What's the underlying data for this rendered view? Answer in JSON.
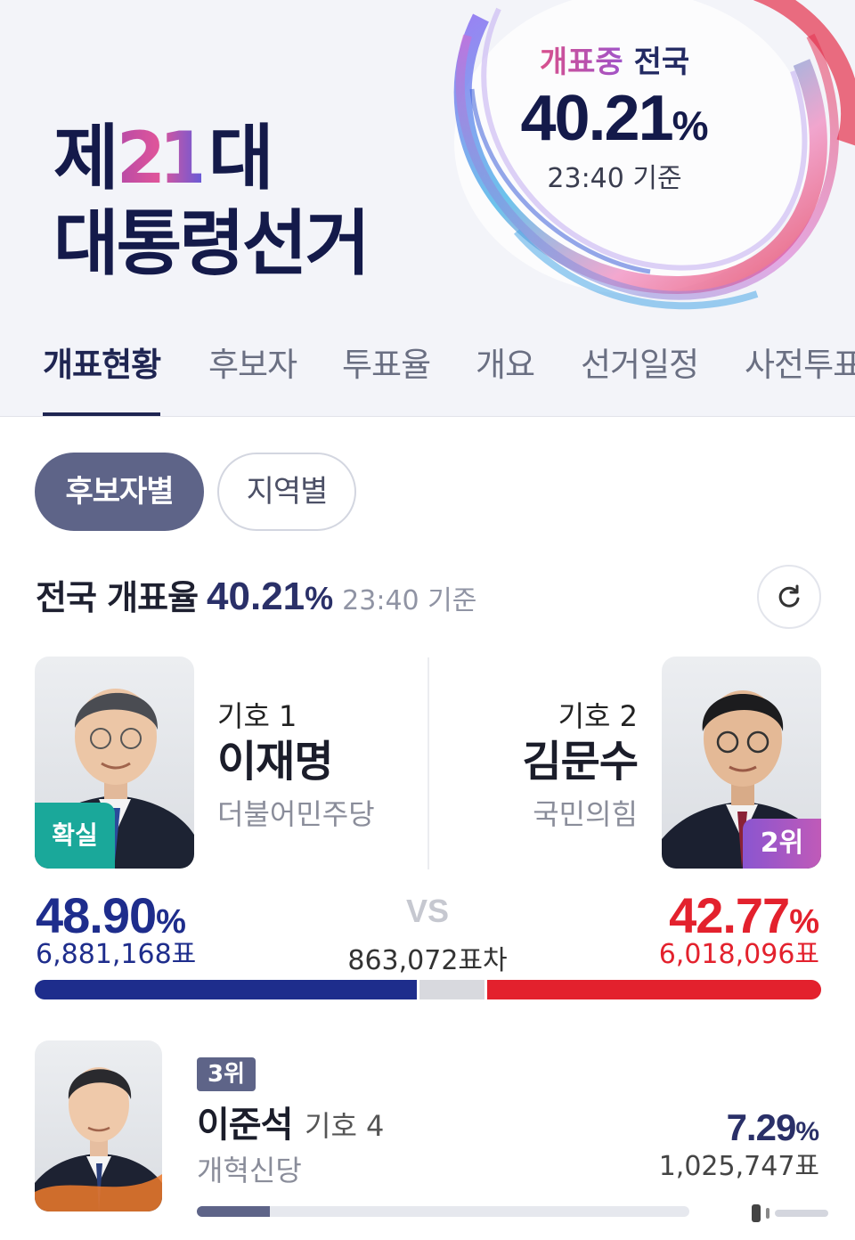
{
  "hero": {
    "title_prefix": "제",
    "title_number": "21",
    "title_suffix": "대",
    "title_line2": "대통령선거",
    "count_label_highlight": "개표중",
    "count_label_rest": "전국",
    "count_percent": "40.21",
    "percent_sign": "%",
    "count_time": "23:40 기준"
  },
  "tabs": [
    "개표현황",
    "후보자",
    "투표율",
    "개요",
    "선거일정",
    "사전투표"
  ],
  "filters": {
    "by_candidate": "후보자별",
    "by_region": "지역별"
  },
  "summary": {
    "label": "전국 개표율",
    "percent": "40.21",
    "percent_sign": "%",
    "time": "23:40 기준"
  },
  "candidates": [
    {
      "number_label": "기호 1",
      "name": "이재명",
      "party": "더불어민주당",
      "badge": "확실",
      "percent": "48.90",
      "percent_sign": "%",
      "votes": "6,881,168표",
      "vote_share": 48.9,
      "color": "#1e2d8c"
    },
    {
      "number_label": "기호 2",
      "name": "김문수",
      "party": "국민의힘",
      "badge": "2위",
      "percent": "42.77",
      "percent_sign": "%",
      "votes": "6,018,096표",
      "vote_share": 42.77,
      "color": "#e3212d"
    }
  ],
  "versus": {
    "label": "VS",
    "gap": "863,072표차"
  },
  "third": {
    "rank": "3위",
    "name": "이준석",
    "number_label": "기호 4",
    "party": "개혁신당",
    "percent": "7.29",
    "percent_sign": "%",
    "votes": "1,025,747표",
    "vote_share": 7.29,
    "color": "#5e6488"
  },
  "colors": {
    "navy": "#141a4a",
    "democratic_blue": "#1e2d8c",
    "ppp_red": "#e3212d",
    "confirmed_teal": "#1aa89a",
    "pill_slate": "#5e6488"
  }
}
